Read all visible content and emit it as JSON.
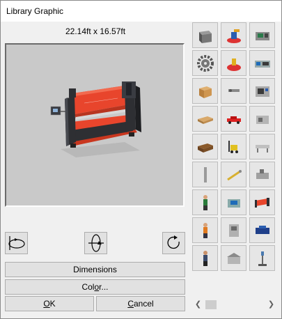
{
  "window": {
    "title": "Library Graphic"
  },
  "preview": {
    "dimensions": "22.14ft x 16.57ft"
  },
  "rotate_buttons": [
    {
      "name": "rotate-horizontal-button",
      "icon": "rotate-horizontal-icon"
    },
    {
      "name": "rotate-vertical-button",
      "icon": "rotate-vertical-icon"
    },
    {
      "name": "rotate-in-plane-button",
      "icon": "rotate-circle-icon"
    }
  ],
  "buttons": {
    "dimensions": "Dimensions",
    "color_pre": "Col",
    "color_u": "o",
    "color_post": "r...",
    "ok_u": "O",
    "ok_post": "K",
    "cancel_u": "C",
    "cancel_post": "ancel"
  },
  "gallery": {
    "thumbnails": [
      "cube-icon",
      "robot-arm-icon",
      "cnc-machine-icon",
      "gear-icon",
      "red-robot-icon",
      "lathe-icon",
      "cardboard-box-icon",
      "small-part-icon",
      "machining-center-icon",
      "wooden-pallet-icon",
      "red-car-icon",
      "grey-machine-icon",
      "pallet-stack-icon",
      "forklift-icon",
      "conveyor-icon",
      "column-icon",
      "tool-arm-icon",
      "milling-machine-icon",
      "worker-icon",
      "press-icon",
      "press-brake-icon",
      "worker-orange-icon",
      "cabinet-machine-icon",
      "blue-machine-icon",
      "person-icon",
      "warehouse-icon",
      "scale-icon"
    ]
  },
  "colors": {
    "machine_orange": "#e8452c",
    "machine_dark": "#2e2f33",
    "preview_bg": "#c9c9c9"
  }
}
